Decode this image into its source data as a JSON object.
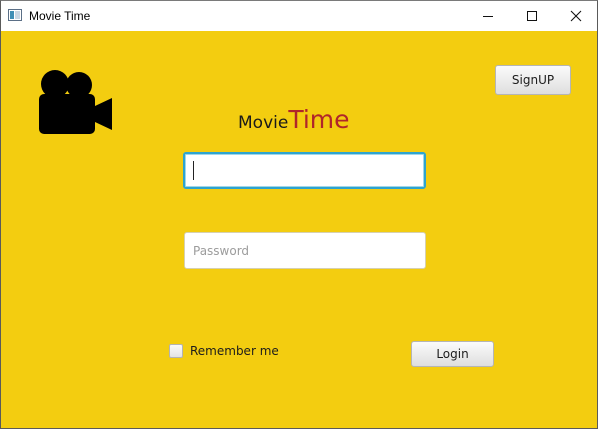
{
  "window": {
    "title": "Movie Time",
    "controls": [
      "minimize-icon",
      "maximize-icon",
      "close-icon"
    ]
  },
  "logo": {
    "icon": "video-camera-icon",
    "part1": "Movie",
    "part2": "Time"
  },
  "header": {
    "signup_label": "SignUP"
  },
  "form": {
    "username": {
      "value": "",
      "placeholder": ""
    },
    "password": {
      "value": "",
      "placeholder": "Password"
    },
    "remember_label": "Remember me",
    "remember_checked": false,
    "login_label": "Login"
  },
  "colors": {
    "background": "#f3cd10",
    "time_text": "#b0262a",
    "focus_border": "#2fa4cf"
  }
}
